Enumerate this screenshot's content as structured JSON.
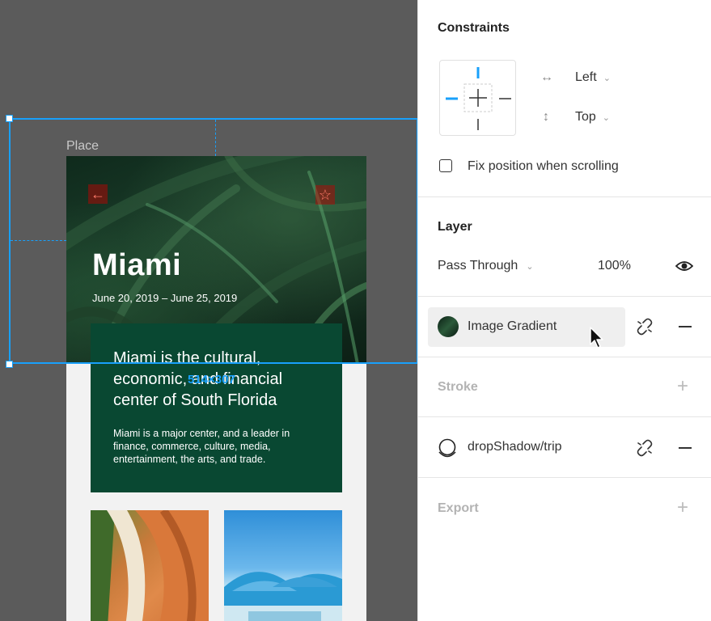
{
  "canvas": {
    "frame_label": "Place",
    "city": "Miami",
    "dates": "June 20, 2019 – June 25, 2019",
    "card_title": "Miami is the cultural, economic, and financial center of South Florida",
    "card_body": "Miami is a major center, and a leader in finance, commerce, culture, media, entertainment, the arts, and trade.",
    "dimension_label": "514×307",
    "accent_color": "#18a0fb",
    "card_color": "#094832"
  },
  "panel": {
    "constraints": {
      "title": "Constraints",
      "horizontal": "Left",
      "vertical": "Top",
      "fix_position_label": "Fix position when scrolling",
      "fix_position_checked": false
    },
    "layer": {
      "title": "Layer",
      "blend_mode": "Pass Through",
      "opacity": "100%"
    },
    "fill": {
      "style_name": "Image Gradient"
    },
    "stroke": {
      "title": "Stroke"
    },
    "effect": {
      "style_name": "dropShadow/trip"
    },
    "export": {
      "title": "Export"
    }
  }
}
